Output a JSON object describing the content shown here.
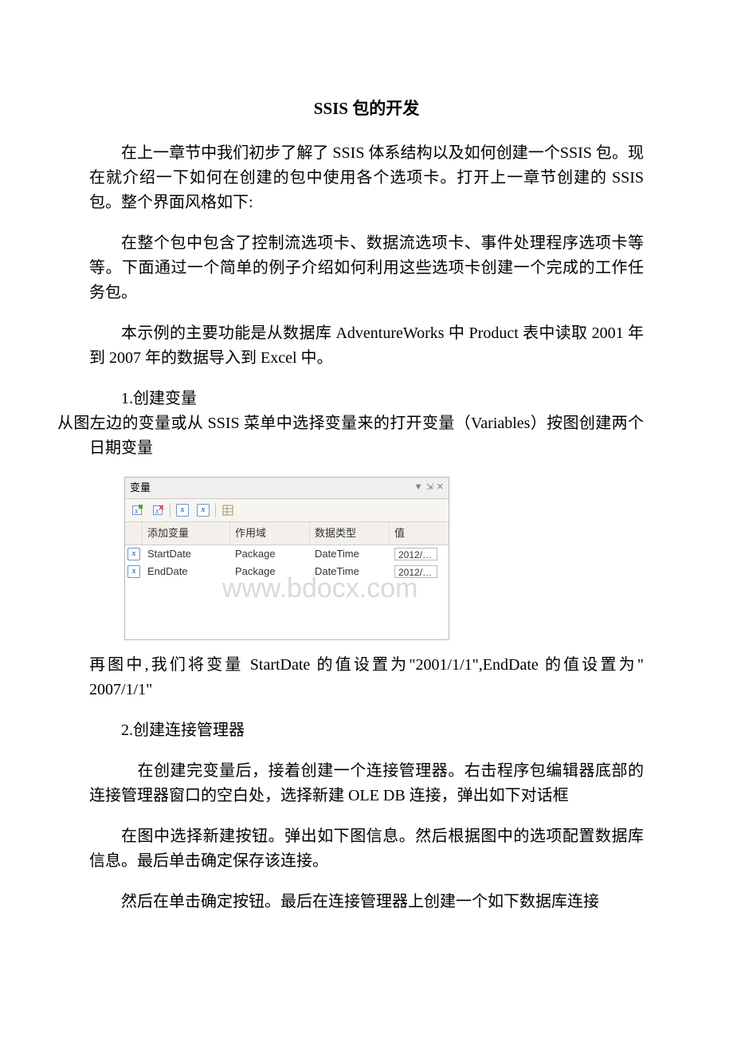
{
  "title": "SSIS 包的开发",
  "para1": "在上一章节中我们初步了解了 SSIS 体系结构以及如何创建一个SSIS 包。现在就介绍一下如何在创建的包中使用各个选项卡。打开上一章节创建的 SSIS 包。整个界面风格如下:",
  "para2": "在整个包中包含了控制流选项卡、数据流选项卡、事件处理程序选项卡等等。下面通过一个简单的例子介绍如何利用这些选项卡创建一个完成的工作任务包。",
  "para3": "本示例的主要功能是从数据库 AdventureWorks 中 Product 表中读取 2001 年到 2007 年的数据导入到 Excel 中。",
  "para4_line1": "1.创建变量",
  "para4_line2": "从图左边的变量或从 SSIS 菜单中选择变量来的打开变量（Variables）按图创建两个日期变量",
  "para5": "再图中,我们将变量 StartDate 的值设置为\"2001/1/1\",EndDate 的值设置为\" 2007/1/1\"",
  "para6": "2.创建连接管理器",
  "para7": "　在创建完变量后，接着创建一个连接管理器。右击程序包编辑器底部的连接管理器窗口的空白处，选择新建 OLE DB 连接，弹出如下对话框",
  "para8": "在图中选择新建按钮。弹出如下图信息。然后根据图中的选项配置数据库信息。最后单击确定保存该连接。",
  "para9": "然后在单击确定按钮。最后在连接管理器上创建一个如下数据库连接",
  "variables_panel": {
    "title": "变量",
    "headers": {
      "name": "添加变量",
      "scope": "作用域",
      "type": "数据类型",
      "value": "值"
    },
    "rows": [
      {
        "name": "StartDate",
        "scope": "Package",
        "type": "DateTime",
        "value": "2012/2/..."
      },
      {
        "name": "EndDate",
        "scope": "Package",
        "type": "DateTime",
        "value": "2012/2/..."
      }
    ],
    "watermark": "www.bdocx.com",
    "icons": {
      "add_var": "add-variable-icon",
      "del_var": "delete-variable-icon",
      "x1": "variable-icon",
      "x2": "variable-icon",
      "props": "properties-icon",
      "ctrl_down": "▼",
      "ctrl_pin": "⇲",
      "ctrl_close": "✕"
    }
  }
}
